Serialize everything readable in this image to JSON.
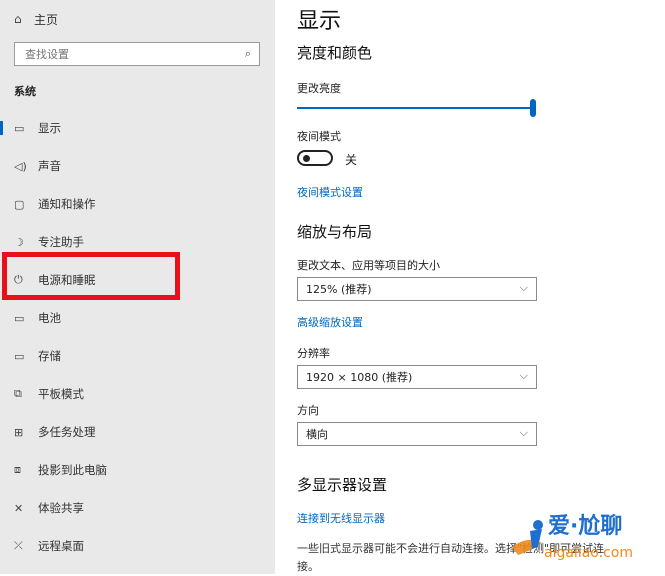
{
  "sidebar": {
    "home": {
      "icon": "home-icon",
      "glyph": "⌂",
      "label": "主页"
    },
    "search": {
      "placeholder": "查找设置",
      "icon": "search-icon"
    },
    "section_title": "系统",
    "items": [
      {
        "icon": "display-icon",
        "glyph": "▭",
        "label": "显示",
        "active": true
      },
      {
        "icon": "sound-icon",
        "glyph": "◁)",
        "label": "声音"
      },
      {
        "icon": "notification-icon",
        "glyph": "▢",
        "label": "通知和操作"
      },
      {
        "icon": "focus-assist-icon",
        "glyph": "☽",
        "label": "专注助手"
      },
      {
        "icon": "power-icon",
        "glyph": "⏻",
        "label": "电源和睡眠"
      },
      {
        "icon": "battery-icon",
        "glyph": "▭",
        "label": "电池"
      },
      {
        "icon": "storage-icon",
        "glyph": "▭",
        "label": "存储"
      },
      {
        "icon": "tablet-mode-icon",
        "glyph": "⧉",
        "label": "平板模式"
      },
      {
        "icon": "multitasking-icon",
        "glyph": "⊞",
        "label": "多任务处理"
      },
      {
        "icon": "projecting-icon",
        "glyph": "⧈",
        "label": "投影到此电脑"
      },
      {
        "icon": "shared-experiences-icon",
        "glyph": "✕",
        "label": "体验共享"
      },
      {
        "icon": "remote-desktop-icon",
        "glyph": "⤫",
        "label": "远程桌面"
      }
    ]
  },
  "main": {
    "page_title": "显示",
    "brightness_section": "亮度和颜色",
    "brightness_label": "更改亮度",
    "brightness_value": 1.0,
    "night_light_label": "夜间模式",
    "night_light_state": "关",
    "night_light_link": "夜间模式设置",
    "scale_section": "缩放与布局",
    "scale_label": "更改文本、应用等项目的大小",
    "scale_value": "125% (推荐)",
    "advanced_scaling_link": "高级缩放设置",
    "resolution_label": "分辨率",
    "resolution_value": "1920 × 1080 (推荐)",
    "orientation_label": "方向",
    "orientation_value": "横向",
    "multi_display_section": "多显示器设置",
    "wireless_link": "连接到无线显示器",
    "multi_display_desc": "一些旧式显示器可能不会进行自动连接。选择\"检测\"即可尝试连",
    "multi_display_desc2": "接。"
  },
  "watermark": {
    "text": "爱·尬聊",
    "url": "aigaliao.com"
  },
  "colors": {
    "accent": "#0067c0",
    "highlight": "#e8101a",
    "sidebar_bg": "#e9e9e9"
  }
}
